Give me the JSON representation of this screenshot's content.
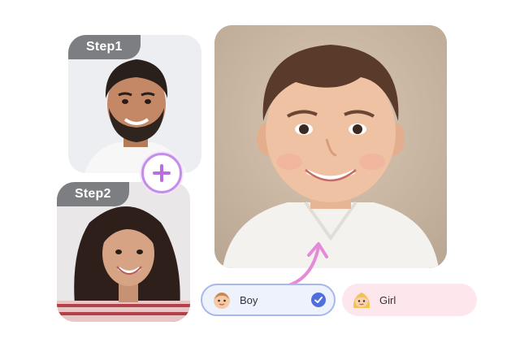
{
  "steps": [
    {
      "label": "Step1"
    },
    {
      "label": "Step2"
    }
  ],
  "options": {
    "boy": {
      "label": "Boy",
      "selected": true
    },
    "girl": {
      "label": "Girl",
      "selected": false
    }
  },
  "colors": {
    "tab_bg": "#7c7e82",
    "plus_accent": "#c38ee8",
    "boy_bg": "#eef2fd",
    "boy_border": "#a9b8ec",
    "girl_bg": "#fde7ec",
    "check": "#4f6fdc",
    "arrow": "#e58ad8"
  },
  "icons": {
    "plus": "plus-icon",
    "check": "checkmark-icon",
    "boy": "baby-boy-emoji-icon",
    "girl": "baby-girl-emoji-icon",
    "arrow": "curved-arrow-icon"
  }
}
